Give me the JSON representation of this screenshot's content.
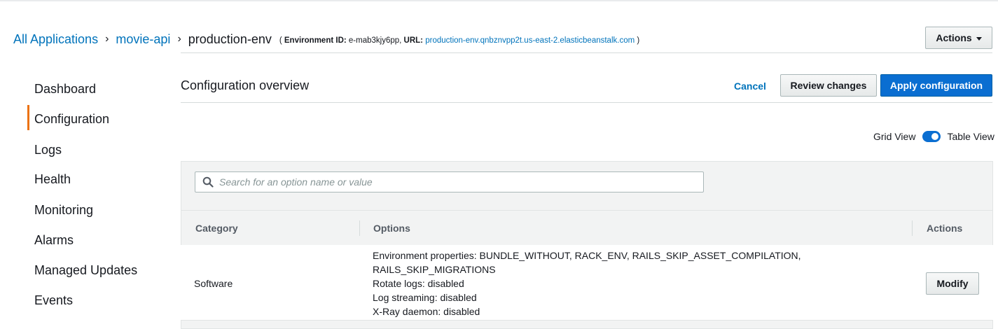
{
  "breadcrumb": {
    "app_link": "All Applications",
    "sep1": "›",
    "application": "movie-api",
    "sep2": "›",
    "environment": "production-env",
    "meta_open": "(",
    "env_id_label": "Environment ID:",
    "env_id_value": "e-mab3kjy6pp,",
    "url_label": "URL:",
    "url_value": "production-env.qnbznvpp2t.us-east-2.elasticbeanstalk.com",
    "meta_close": ")"
  },
  "header": {
    "actions_label": "Actions"
  },
  "sidebar": {
    "active": "Configuration",
    "items": [
      {
        "label": "Dashboard"
      },
      {
        "label": "Configuration"
      },
      {
        "label": "Logs"
      },
      {
        "label": "Health"
      },
      {
        "label": "Monitoring"
      },
      {
        "label": "Alarms"
      },
      {
        "label": "Managed Updates"
      },
      {
        "label": "Events"
      }
    ]
  },
  "config": {
    "title": "Configuration overview",
    "cancel_label": "Cancel",
    "review_label": "Review changes",
    "apply_label": "Apply configuration"
  },
  "view_toggle": {
    "left_label": "Grid View",
    "right_label": "Table View",
    "selected": "Table View"
  },
  "search": {
    "placeholder": "Search for an option name or value",
    "value": ""
  },
  "table": {
    "headers": [
      "Category",
      "Options",
      "Actions"
    ],
    "rows": [
      {
        "category": "Software",
        "options": [
          "Environment properties: BUNDLE_WITHOUT, RACK_ENV, RAILS_SKIP_ASSET_COMPILATION,",
          "RAILS_SKIP_MIGRATIONS",
          "Rotate logs: disabled",
          "Log streaming: disabled",
          "X-Ray daemon: disabled"
        ],
        "action_label": "Modify"
      }
    ]
  },
  "colors": {
    "link": "#0073bb",
    "primary": "#0a6ed1",
    "active_nav": "#ec7211",
    "panel": "#f2f3f3"
  }
}
